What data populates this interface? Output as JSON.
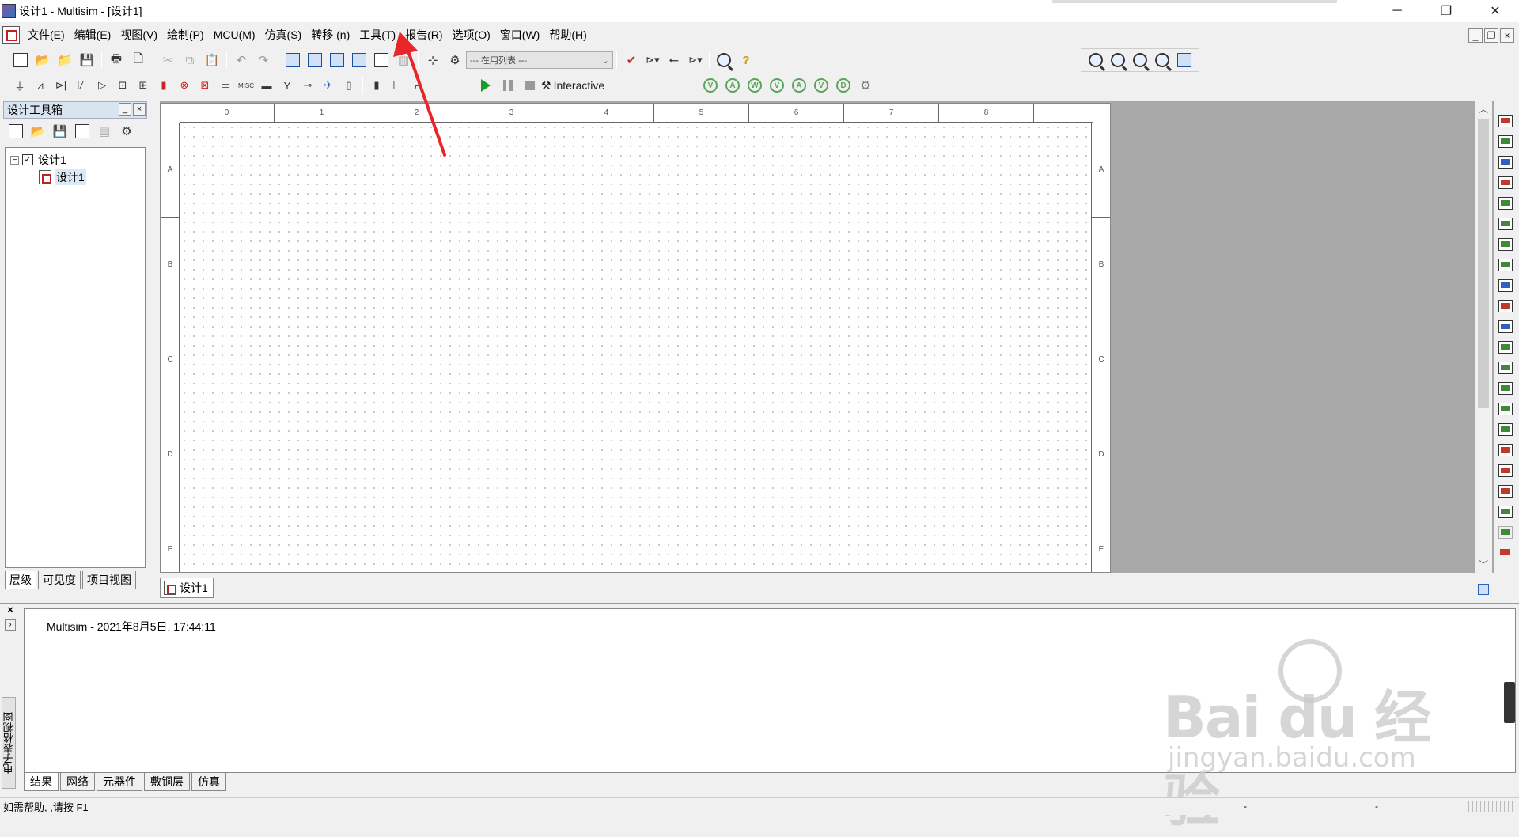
{
  "window": {
    "title": "设计1 - Multisim - [设计1]",
    "controls": [
      "─",
      "❐",
      "✕"
    ]
  },
  "menubar": {
    "items": [
      "文件(E)",
      "编辑(E)",
      "视图(V)",
      "绘制(P)",
      "MCU(M)",
      "仿真(S)",
      "转移 (n)",
      "工具(T)",
      "报告(R)",
      "选项(O)",
      "窗口(W)",
      "帮助(H)"
    ],
    "mdi_controls": [
      "_",
      "❐",
      "×"
    ]
  },
  "toolbar": {
    "inuse_list": "--- 在用列表 ---",
    "sim_mode": "Interactive"
  },
  "design_toolbox": {
    "title": "设计工具箱",
    "tree_root": "设计1",
    "tree_child": "设计1",
    "tabs": [
      "层级",
      "可见度",
      "项目视图"
    ]
  },
  "sheet": {
    "columns": [
      "0",
      "1",
      "2",
      "3",
      "4",
      "5",
      "6",
      "7",
      "8"
    ],
    "rows": [
      "A",
      "B",
      "C",
      "D",
      "E"
    ],
    "tab_label": "设计1"
  },
  "spreadsheet": {
    "side_label": "电子表格视图",
    "log_line": "Multisim  -  2021年8月5日, 17:44:11",
    "tabs": [
      "结果",
      "网络",
      "元器件",
      "敷铜层",
      "仿真"
    ]
  },
  "statusbar": {
    "help_text": "如需帮助, ,请按 F1",
    "cells": [
      "-",
      "-"
    ]
  },
  "watermark": {
    "main": "Bai du 经验",
    "sub": "jingyan.baidu.com"
  },
  "colors": {
    "accent_red": "#e8262a",
    "sim_green": "#1a9c2b",
    "panel_title_bg": "#d9e4f1"
  }
}
